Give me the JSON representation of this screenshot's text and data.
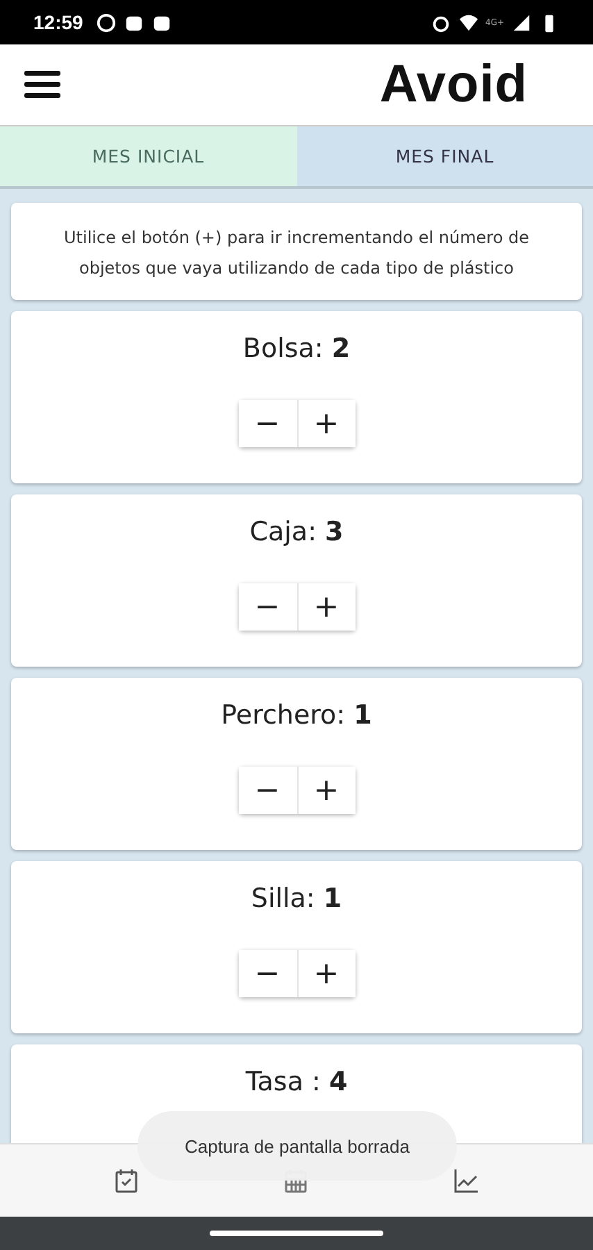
{
  "status_bar": {
    "time": "12:59",
    "network": "4G+"
  },
  "app_bar": {
    "title": "Avoid"
  },
  "tabs": [
    {
      "label": "MES INICIAL",
      "selected": true
    },
    {
      "label": "MES FINAL",
      "selected": false
    }
  ],
  "instructions": "Utilice el botón (+) para ir incrementando el número de objetos que vaya utilizando de cada tipo de plástico",
  "items": [
    {
      "label": "Bolsa:",
      "count": "2",
      "minus": "−",
      "plus": "+"
    },
    {
      "label": "Caja:",
      "count": "3",
      "minus": "−",
      "plus": "+"
    },
    {
      "label": "Perchero:",
      "count": "1",
      "minus": "−",
      "plus": "+"
    },
    {
      "label": "Silla:",
      "count": "1",
      "minus": "−",
      "plus": "+"
    },
    {
      "label": "Tasa :",
      "count": "4"
    }
  ],
  "toast": "Captura de pantalla borrada"
}
